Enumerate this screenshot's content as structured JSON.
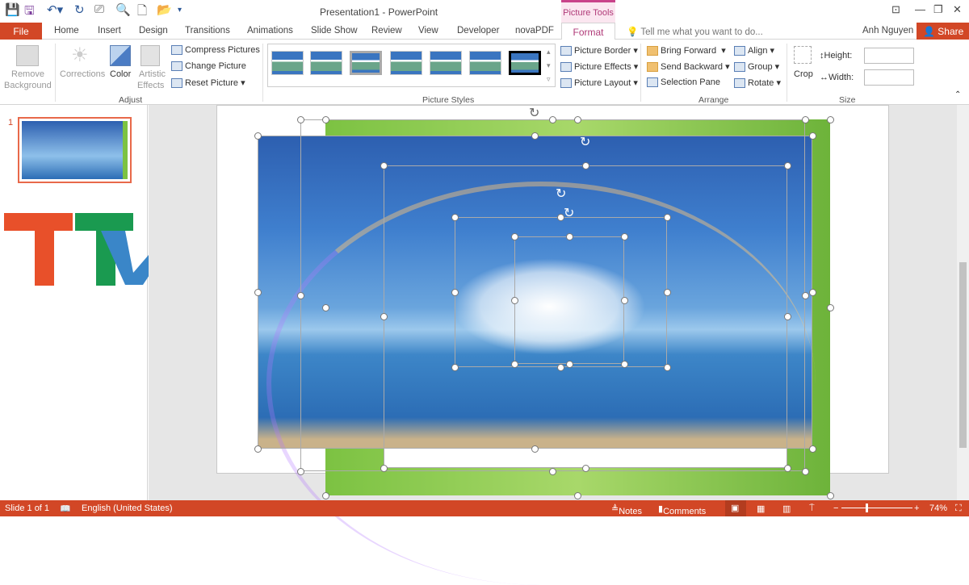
{
  "window": {
    "title": "Presentation1 - PowerPoint",
    "context_tab": "Picture Tools"
  },
  "tabs": {
    "file": "File",
    "items": [
      "Home",
      "Insert",
      "Design",
      "Transitions",
      "Animations",
      "Slide Show",
      "Review",
      "View",
      "Developer",
      "novaPDF"
    ],
    "format": "Format",
    "tell_me": "Tell me what you want to do...",
    "user": "Anh Nguyen",
    "share": "Share"
  },
  "ribbon": {
    "adjust": {
      "remove_bg": "Remove",
      "remove_bg2": "Background",
      "corrections": "Corrections",
      "color": "Color",
      "artistic": "Artistic",
      "artistic2": "Effects",
      "compress": "Compress Pictures",
      "change": "Change Picture",
      "reset": "Reset Picture",
      "label": "Adjust"
    },
    "styles": {
      "label": "Picture Styles",
      "border": "Picture Border",
      "effects": "Picture Effects",
      "layout": "Picture Layout"
    },
    "arrange": {
      "bring_forward": "Bring Forward",
      "send_backward": "Send Backward",
      "selection_pane": "Selection Pane",
      "align": "Align",
      "group": "Group",
      "rotate": "Rotate",
      "label": "Arrange"
    },
    "size": {
      "crop": "Crop",
      "height": "Height:",
      "width": "Width:",
      "height_value": "",
      "width_value": "",
      "label": "Size"
    }
  },
  "thumbnail": {
    "number": "1"
  },
  "status": {
    "slide": "Slide 1 of 1",
    "language": "English (United States)",
    "notes": "Notes",
    "comments": "Comments",
    "zoom": "74%",
    "zoom_level": 74
  },
  "colors": {
    "accent": "#d24726",
    "context": "#b03a78"
  }
}
